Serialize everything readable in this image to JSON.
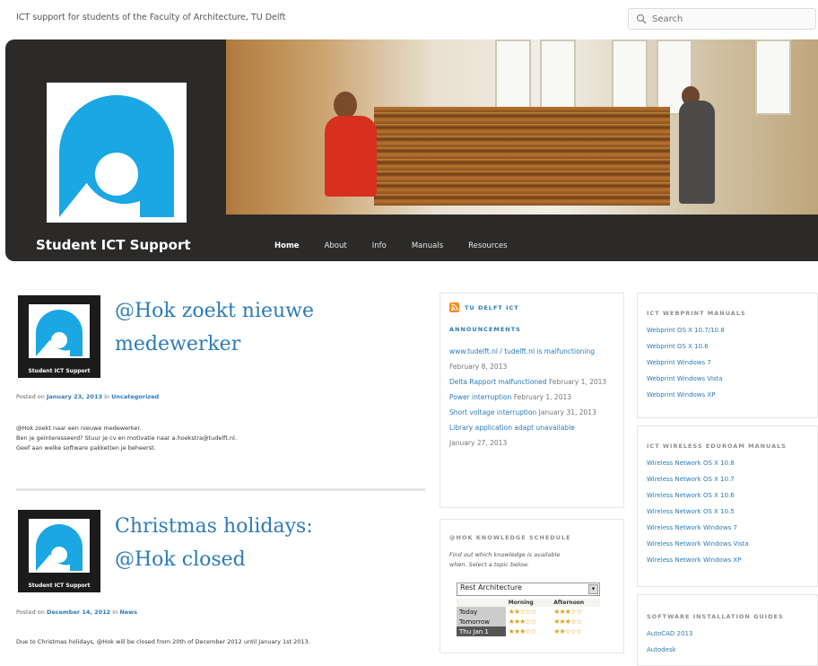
{
  "header": {
    "tagline": "ICT support for students of the Faculty of Architecture, TU Delft",
    "search_placeholder": "Search",
    "site_title": "Student ICT Support",
    "nav": [
      "Home",
      "About",
      "Info",
      "Manuals",
      "Resources"
    ]
  },
  "posts": [
    {
      "title_line1": "@Hok zoekt nieuwe",
      "title_line2": "medewerker",
      "thumb_caption": "Student ICT Support",
      "meta_prefix": "Posted on",
      "date": "January 23, 2013",
      "meta_by": "in",
      "category": "Uncategorized",
      "excerpt": [
        "@Hok zoekt naar een nieuwe medewerker.",
        "Ben je geïnteresseerd? Stuur je cv en motivatie naar a.hoekstra@tudelft.nl.",
        "Geef aan welke software pakketten je beheerst."
      ]
    },
    {
      "title_line1": "Christmas holidays:",
      "title_line2": "@Hok closed",
      "thumb_caption": "Student ICT Support",
      "meta_prefix": "Posted on",
      "date": "December 14, 2012",
      "meta_by": "in",
      "category": "News",
      "excerpt": [
        "Due to Christmas holidays, @Hok will be closed from 20th of December 2012 until January 1st 2013."
      ]
    }
  ],
  "sidebar_mid": {
    "announcements_title_line1": "TU DELFT ICT",
    "announcements_title_line2": "ANNOUNCEMENTS",
    "announcements": [
      {
        "text": "www.tudelft.nl / tudelft.nl is malfunctioning",
        "date": "February 8, 2013"
      },
      {
        "text": "Delta Rapport malfunctioned",
        "date": "February 1, 2013"
      },
      {
        "text": "Power interruption",
        "date": "February 1, 2013"
      },
      {
        "text": "Short voltage interruption",
        "date": "January 31, 2013"
      },
      {
        "text": "Library application adapt unavailable",
        "date": "January 27, 2013"
      }
    ],
    "kb_title": "@HOK KNOWLEDGE SCHEDULE",
    "kb_desc_line1": "Find out which knowledge is available",
    "kb_desc_line2": "when. Select a topic below.",
    "kb_selected": "Rest Architecture",
    "kb_col_morning": "Morning",
    "kb_col_afternoon": "Afternoon",
    "kb_rows": [
      {
        "day": "Today",
        "morning": "★★☆☆☆",
        "afternoon": "★★★☆☆"
      },
      {
        "day": "Tomorrow",
        "morning": "★★★☆☆",
        "afternoon": "★★★☆☆"
      },
      {
        "day": "Thu Jan 1",
        "morning": "★★★☆☆",
        "afternoon": "★★☆☆☆"
      }
    ]
  },
  "sidebar_right": {
    "webprint_title": "ICT WEBPRINT MANUALS",
    "webprint_links": [
      "Webprint OS X 10.7/10.8",
      "Webprint OS X 10.6",
      "Webprint Windows 7",
      "Webprint Windows Vista",
      "Webprint Windows XP"
    ],
    "wireless_title": "ICT WIRELESS EDUROAM MANUALS",
    "wireless_links": [
      "Wireless Network OS X 10.8",
      "Wireless Network OS X 10.7",
      "Wireless Network OS X 10.6",
      "Wireless Network OS X 10.5",
      "Wireless Network Windows 7",
      "Wireless Network Windows Vista",
      "Wireless Network Windows XP"
    ],
    "software_title": "SOFTWARE INSTALLATION GUIDES",
    "software_links": [
      "AutoCAD 2013",
      "Autodesk"
    ]
  },
  "colors": {
    "link": "#2b7bb9",
    "logo_blue": "#1aa7e3",
    "banner_dark": "#2b2a29"
  }
}
